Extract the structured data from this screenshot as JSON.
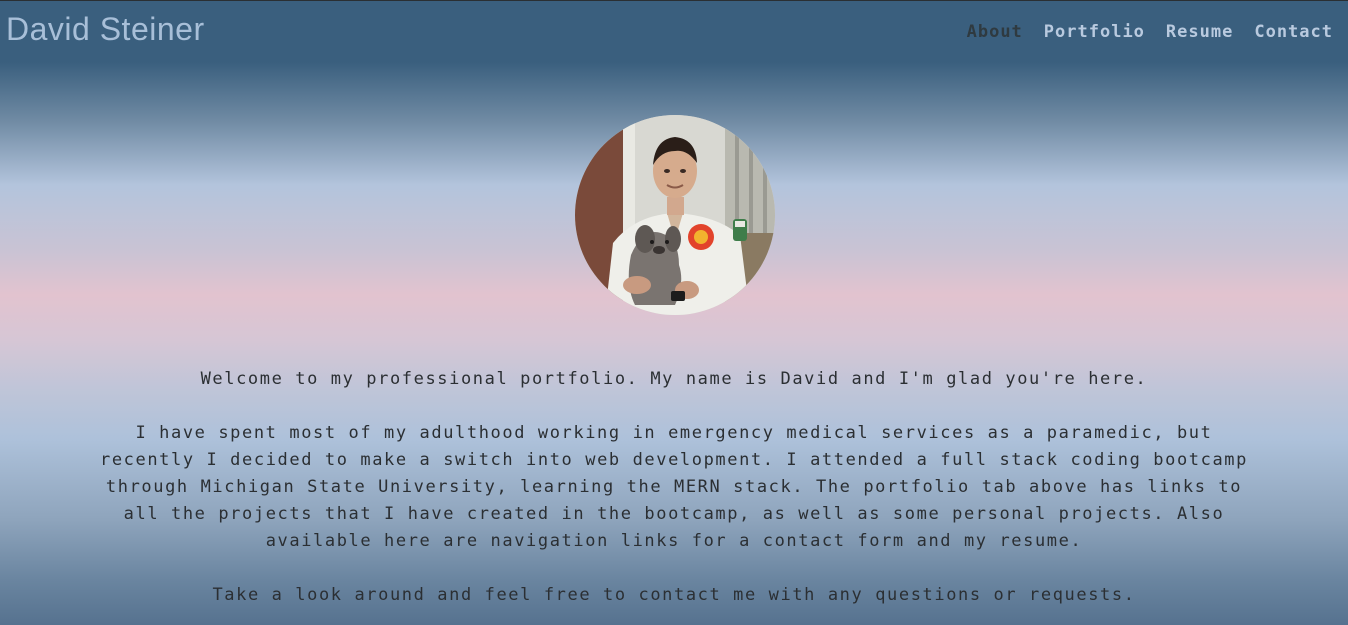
{
  "header": {
    "brand": "David Steiner",
    "nav": [
      "About",
      "Portfolio",
      "Resume",
      "Contact"
    ],
    "active_nav": "About"
  },
  "profile": {
    "photo": "profile-photo"
  },
  "intro": {
    "welcome": "Welcome to my professional portfolio. My name is David and I'm glad you're here.",
    "bio": "I have spent most of my adulthood working in emergency medical services as a paramedic, but recently I decided to make a switch into web development. I attended a full stack coding bootcamp through Michigan State University, learning the MERN stack. The portfolio tab above has links to all the projects that I have created in the bootcamp, as well as some personal projects. Also available here are navigation links for a contact form and my resume.",
    "closing": "Take a look around and feel free to contact me with any questions or requests."
  },
  "colors": {
    "header_bg": "#3a5f7e",
    "brand": "#a8bfd8",
    "nav_link": "#b9cadf",
    "nav_active": "#2f3a40",
    "text": "#2b2f33"
  }
}
